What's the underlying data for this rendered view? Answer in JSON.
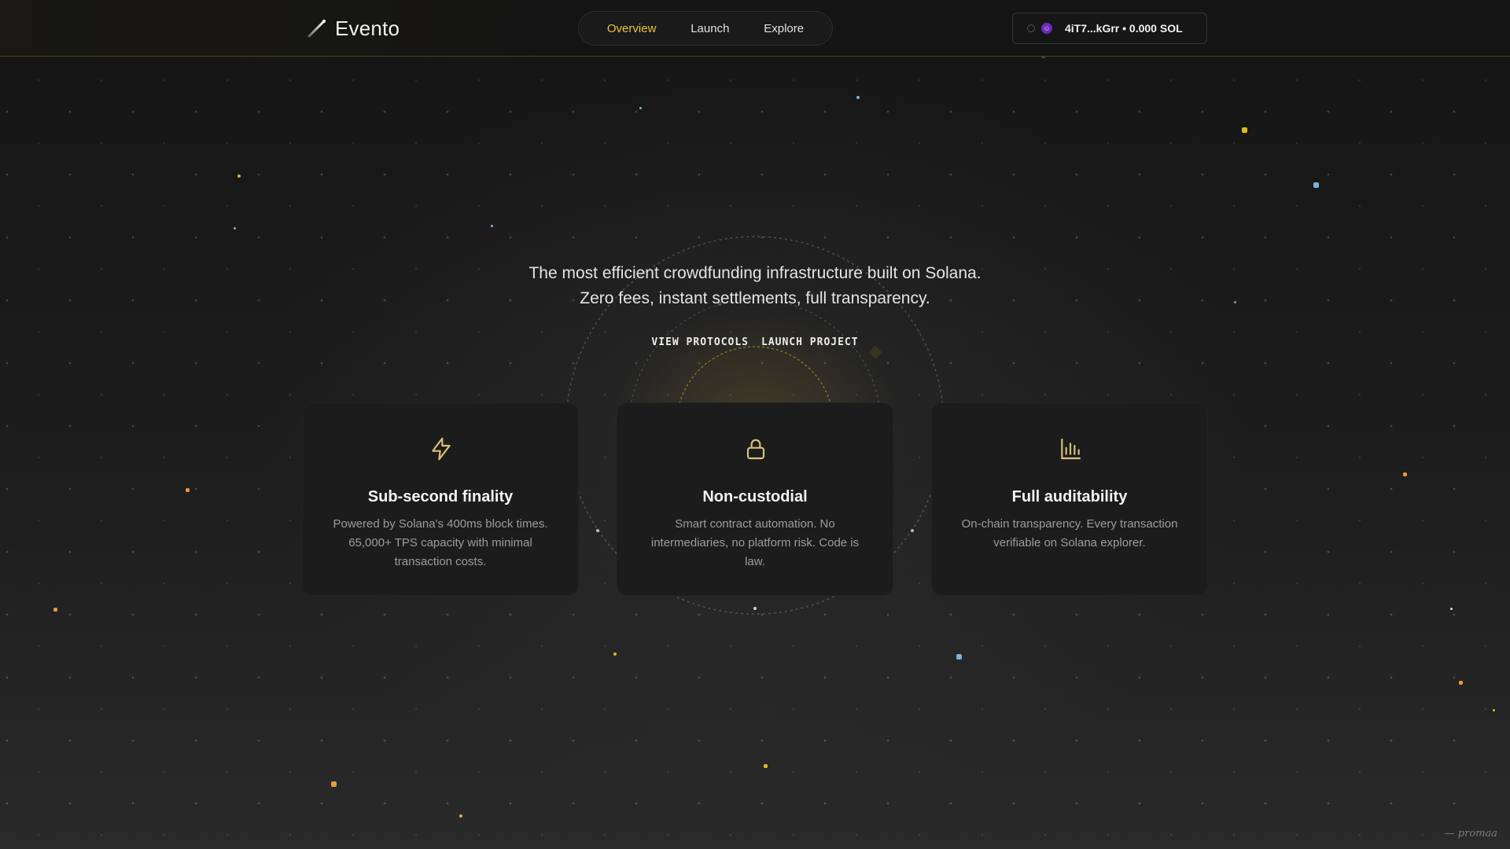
{
  "app": {
    "brand": "Evento"
  },
  "nav": {
    "tabs": [
      {
        "label": "Overview",
        "active": true
      },
      {
        "label": "Launch",
        "active": false
      },
      {
        "label": "Explore",
        "active": false
      }
    ]
  },
  "wallet": {
    "label": "4iT7...kGrr • 0.000 SOL",
    "avatar_glyph": "☺"
  },
  "hero": {
    "line1": "The most efficient crowdfunding infrastructure built on Solana.",
    "line2": "Zero fees, instant settlements, full transparency.",
    "cta_primary": "VIEW PROTOCOLS",
    "cta_secondary": "LAUNCH PROJECT"
  },
  "features": [
    {
      "icon": "lightning-icon",
      "title": "Sub-second finality",
      "desc": "Powered by Solana's 400ms block times. 65,000+ TPS capacity with minimal transaction costs."
    },
    {
      "icon": "lock-icon",
      "title": "Non-custodial",
      "desc": "Smart contract automation. No intermediaries, no platform risk. Code is law."
    },
    {
      "icon": "bar-chart-icon",
      "title": "Full auditability",
      "desc": "On-chain transparency. Every transaction verifiable on Solana explorer."
    }
  ],
  "footer": {
    "credit": "— promaa"
  },
  "colors": {
    "accent": "#e8c53a",
    "icon": "#d9c27a",
    "background": "#1b1b1b",
    "card": "#1c1c1c",
    "muted_text": "#9c9c9c"
  }
}
